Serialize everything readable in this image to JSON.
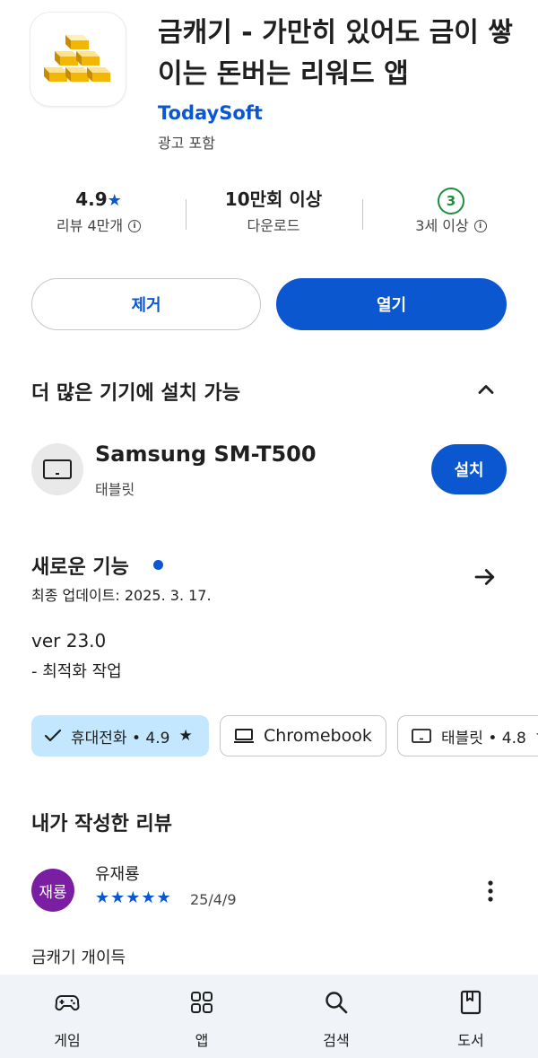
{
  "app": {
    "title": "금캐기 - 가만히 있어도 금이 쌓이는 돈버는 리워드 앱",
    "developer": "TodaySoft",
    "ads_label": "광고 포함",
    "icon": "gold-bars-icon"
  },
  "stats": {
    "rating": "4.9",
    "reviews": "리뷰 4만개",
    "downloads": "10만회 이상",
    "downloads_label": "다운로드",
    "age_badge": "3",
    "age_label": "3세 이상"
  },
  "actions": {
    "remove": "제거",
    "open": "열기"
  },
  "more_devices": {
    "title": "더 많은 기기에 설치 가능",
    "device_name": "Samsung SM-T500",
    "device_type": "태블릿",
    "install": "설치"
  },
  "whats_new": {
    "title": "새로운 기능",
    "updated": "최종 업데이트: 2025. 3. 17.",
    "version": "ver 23.0",
    "notes": "- 최적화 작업"
  },
  "chips": [
    {
      "label": "휴대전화 • 4.9",
      "selected": true
    },
    {
      "label": "Chromebook",
      "selected": false
    },
    {
      "label": "태블릿 • 4.8",
      "selected": false
    }
  ],
  "my_review": {
    "title": "내가 작성한 리뷰",
    "avatar_text": "재룡",
    "reviewer": "유재룡",
    "stars": "★★★★★",
    "rating": 5,
    "date": "25/4/9",
    "text": "금캐기 개이득"
  },
  "bottom_nav": [
    {
      "label": "게임",
      "icon": "gamepad-icon"
    },
    {
      "label": "앱",
      "icon": "apps-grid-icon"
    },
    {
      "label": "검색",
      "icon": "search-icon"
    },
    {
      "label": "도서",
      "icon": "book-icon"
    }
  ],
  "colors": {
    "accent": "#0b57d0",
    "chip_selected": "#c2e7ff",
    "age_green": "#1e8e3e",
    "avatar": "#7b1fa2",
    "nav_bg": "#f0f4f9"
  }
}
